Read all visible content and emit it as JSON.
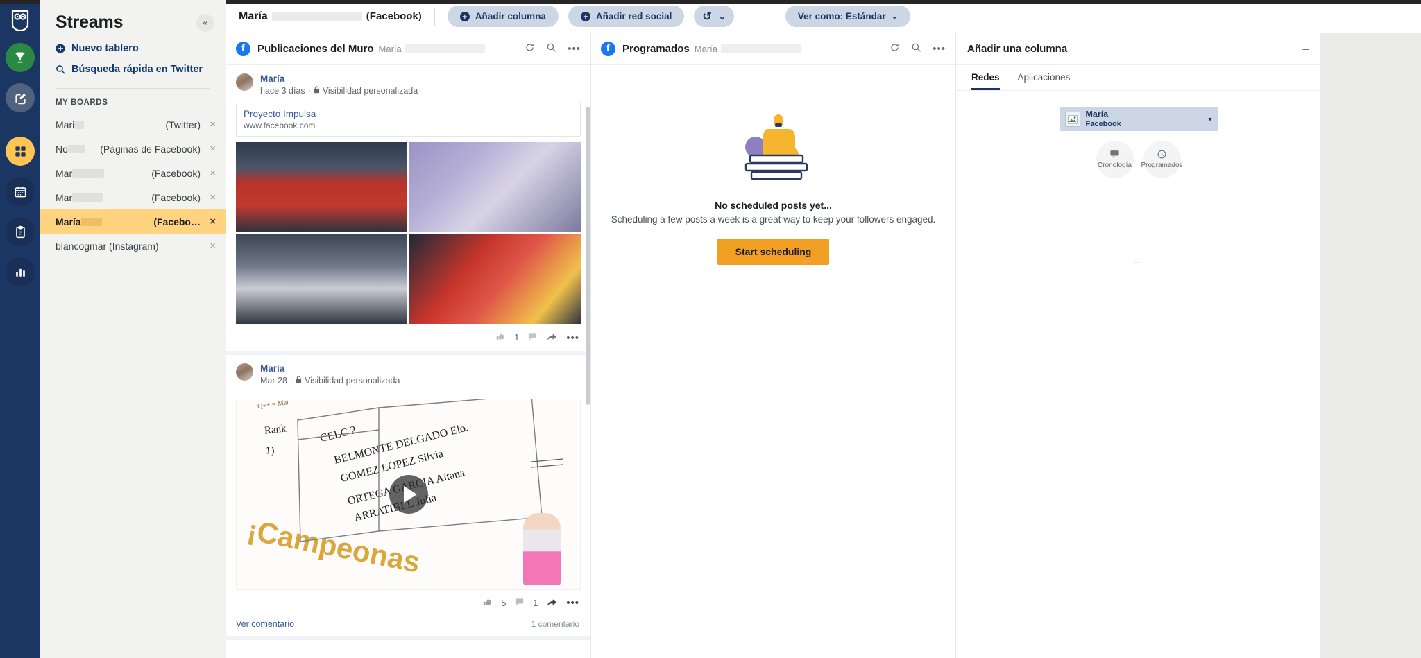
{
  "rail": {
    "logo": "hootsuite-owl-logo",
    "items": [
      {
        "name": "rewards-icon",
        "glyph": "trophy"
      },
      {
        "name": "compose-icon",
        "glyph": "compose"
      },
      {
        "name": "streams-icon",
        "glyph": "grid"
      },
      {
        "name": "planner-icon",
        "glyph": "calendar"
      },
      {
        "name": "inbox-icon",
        "glyph": "clipboard"
      },
      {
        "name": "analytics-icon",
        "glyph": "bars"
      }
    ]
  },
  "sidebar": {
    "title": "Streams",
    "collapse_glyph": "«",
    "new_board": "Nuevo tablero",
    "quick_search": "Búsqueda rápida en Twitter",
    "section_label": "MY BOARDS",
    "boards": [
      {
        "name": "Mari",
        "network": "(Twitter)",
        "active": false,
        "redacted": true
      },
      {
        "name": "No",
        "network": "(Páginas de Facebook)",
        "active": false,
        "redacted": true
      },
      {
        "name": "Mar",
        "network": "(Facebook)",
        "active": false,
        "redacted": true
      },
      {
        "name": "Mar",
        "network": "(Facebook)",
        "active": false,
        "redacted": true
      },
      {
        "name": "María",
        "network": "(Facebo…",
        "active": true,
        "redacted": true
      },
      {
        "name": "blancogmar (Instagram)",
        "network": "",
        "active": false,
        "redacted": false
      }
    ],
    "close_glyph": "×"
  },
  "topbar": {
    "board_name": "María",
    "board_network": "(Facebook)",
    "add_column": "Añadir columna",
    "add_social": "Añadir red social",
    "refresh_glyph": "↺",
    "caret_glyph": "⌄",
    "view_as": "Ver como: Estándar",
    "plus_glyph": "+"
  },
  "columns": [
    {
      "title": "Publicaciones del Muro",
      "subtitle": "María",
      "network_icon": "facebook-icon",
      "actions": [
        "refresh-icon",
        "search-icon",
        "more-icon"
      ],
      "posts": [
        {
          "author": "María",
          "time": "hace 3 días",
          "privacy": "Visibilidad personalizada",
          "link_title": "Proyecto Impulsa",
          "link_url": "www.facebook.com",
          "likes": "1",
          "comments": "",
          "media": "photo-grid"
        },
        {
          "author": "María",
          "time": "Mar 28",
          "privacy": "Visibilidad personalizada",
          "likes": "5",
          "comments": "1",
          "media": "video",
          "video_lines": [
            "Q++ = Mat",
            "Rank",
            "CELC 2",
            "1)",
            "BELMONTE DELGADO Elo.",
            "GOMEZ LOPEZ Silvia",
            "ORTEGA GARCIA Aitana",
            "ARRATIBEL Julia",
            "¡Campeonas"
          ],
          "view_comment": "Ver comentario",
          "comment_count": "1 comentario"
        }
      ]
    },
    {
      "title": "Programados",
      "subtitle": "María",
      "network_icon": "facebook-icon",
      "actions": [
        "refresh-icon",
        "search-icon",
        "more-icon"
      ],
      "empty": {
        "title": "No scheduled posts yet...",
        "subtitle": "Scheduling a few posts a week is a great way to keep your followers engaged.",
        "button": "Start scheduling",
        "illustration": "cat-on-books"
      }
    }
  ],
  "add_column": {
    "title": "Añadir una columna",
    "minimize_glyph": "−",
    "tabs": [
      {
        "label": "Redes",
        "active": true
      },
      {
        "label": "Aplicaciones",
        "active": false
      }
    ],
    "account": {
      "name": "María",
      "network": "Facebook",
      "caret_glyph": "▾",
      "avatar": "broken-image-icon"
    },
    "stream_buttons": [
      {
        "label": "Cronología",
        "icon": "timeline-icon"
      },
      {
        "label": "Programados",
        "icon": "clock-icon"
      }
    ],
    "more_glyph": "···"
  },
  "colors": {
    "rail_bg": "#1c3663",
    "accent_amber": "#ffd380",
    "facebook_blue": "#1877f2",
    "button_amber": "#f2a024",
    "pill_bg": "#ccd6e4"
  }
}
